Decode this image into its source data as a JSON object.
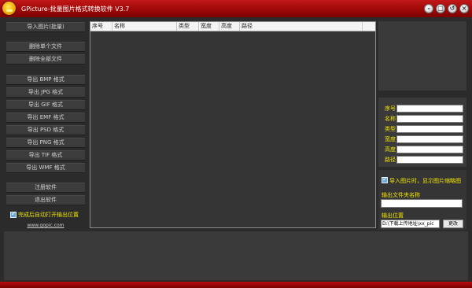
{
  "window": {
    "title": "GPicture-批量图片格式转换软件  V3.7",
    "buttons": [
      "-",
      "▢",
      "↺",
      "×"
    ]
  },
  "sidebar": {
    "import_label": "导入图片(批量)",
    "delete_single": "删除单个文件",
    "delete_all": "删除全部文件",
    "export_buttons": [
      "导出 BMP 格式",
      "导出 JPG 格式",
      "导出 GIF 格式",
      "导出 EMF 格式",
      "导出 PSD 格式",
      "导出 PNG 格式",
      "导出 TIF 格式",
      "导出 WMF 格式"
    ],
    "register": "注册软件",
    "exit": "退出软件",
    "auto_open_label": "完成后自动打开输出位置",
    "auto_open_checked": true,
    "website": "www.gopic.com"
  },
  "file_list": {
    "columns": [
      "序号",
      "名称",
      "类型",
      "宽度",
      "高度",
      "路径"
    ],
    "rows": []
  },
  "properties": {
    "labels": [
      "序号",
      "名称",
      "类型",
      "宽度",
      "高度",
      "路径"
    ],
    "values": [
      "",
      "",
      "",
      "",
      "",
      ""
    ]
  },
  "output": {
    "thumbnail_label": "导入图片时，显示图片缩略图",
    "thumbnail_checked": true,
    "folder_name_label": "输出文件夹名称",
    "folder_name_value": "",
    "location_label": "输出位置",
    "location_value": "D:\\下载上传地址\\xx_pic",
    "change_button": "更改"
  },
  "colors": {
    "title_red": "#9c0707",
    "accent_yellow": "#f2e500",
    "panel_dark": "#2b2b2b"
  }
}
